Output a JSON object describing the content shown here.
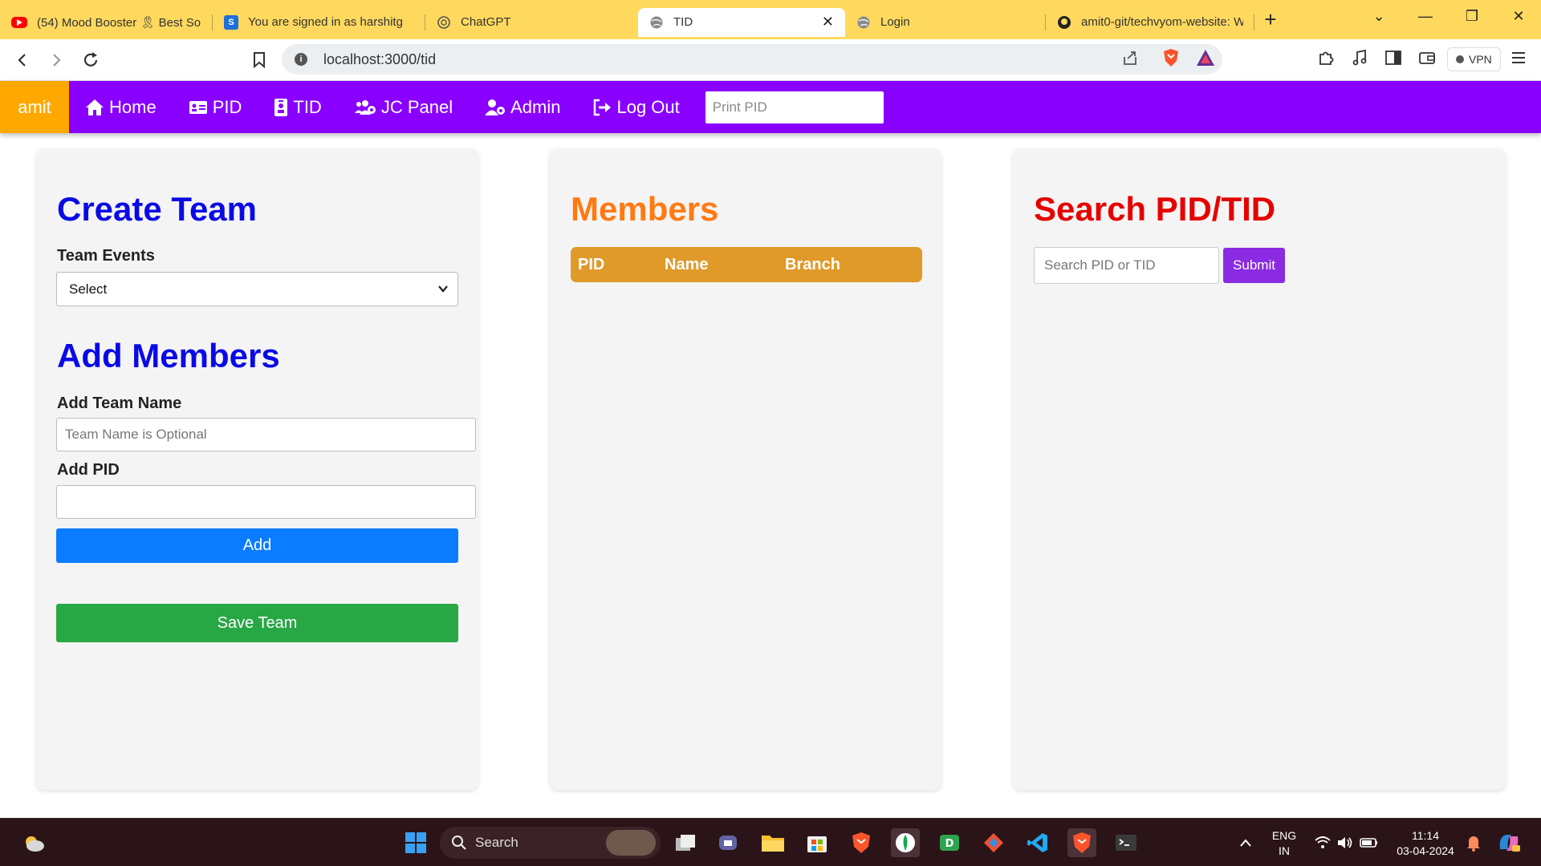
{
  "browser": {
    "tabs": [
      {
        "title": "(54) Mood Booster 🎗 Best Son",
        "icon": "youtube-icon",
        "color": "#ff0000"
      },
      {
        "title": "You are signed in as harshitg",
        "icon": "s-app-icon",
        "color": "#1e6fd9"
      },
      {
        "title": "ChatGPT",
        "icon": "chatgpt-icon",
        "color": "#10a37f"
      },
      {
        "title": "TID",
        "icon": "globe-icon",
        "active": true
      },
      {
        "title": "Login",
        "icon": "globe-icon"
      },
      {
        "title": "amit0-git/techvyom-website: W",
        "icon": "github-icon"
      }
    ],
    "url": "localhost:3000/tid",
    "vpn_label": "VPN"
  },
  "navbar": {
    "brand": "amit",
    "items": [
      {
        "label": "Home",
        "icon": "home-icon"
      },
      {
        "label": "PID",
        "icon": "id-card-icon"
      },
      {
        "label": "TID",
        "icon": "id-badge-icon"
      },
      {
        "label": "JC Panel",
        "icon": "users-cog-icon"
      },
      {
        "label": "Admin",
        "icon": "user-cog-icon"
      },
      {
        "label": "Log Out",
        "icon": "sign-out-icon"
      }
    ],
    "print_pid_placeholder": "Print PID",
    "color": "#8a00ff",
    "brand_color": "#ffa800"
  },
  "create_team": {
    "title": "Create Team",
    "title_color": "#0a0ae6",
    "team_events_label": "Team Events",
    "team_events_selected": "Select",
    "add_members_title": "Add Members",
    "team_name_label": "Add Team Name",
    "team_name_placeholder": "Team Name is Optional",
    "pid_label": "Add PID",
    "pid_value": "",
    "add_button": "Add",
    "add_button_color": "#0a7cff",
    "save_button": "Save Team",
    "save_button_color": "#28a745"
  },
  "members": {
    "title": "Members",
    "title_color": "#ff7a12",
    "columns": [
      "PID",
      "Name",
      "Branch"
    ],
    "header_color": "#e09a2a",
    "rows": []
  },
  "search": {
    "title": "Search PID/TID",
    "title_color": "#e60000",
    "placeholder": "Search PID or TID",
    "submit_label": "Submit",
    "submit_color": "#8a2be2"
  },
  "taskbar": {
    "search_label": "Search",
    "language": "ENG",
    "region": "IN",
    "time": "11:14",
    "date": "03-04-2024"
  }
}
